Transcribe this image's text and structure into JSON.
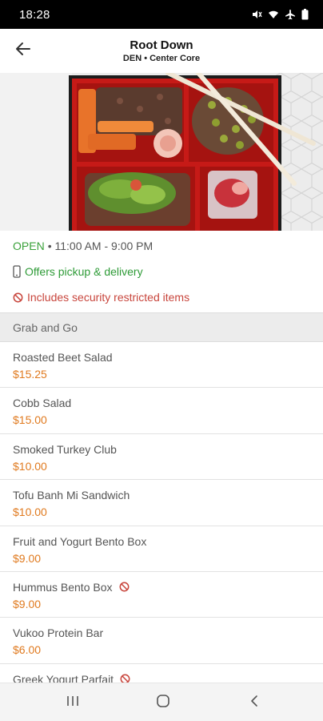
{
  "status_bar": {
    "time": "18:28",
    "icons": [
      "mute-icon",
      "wifi-icon",
      "airplane-icon",
      "battery-icon"
    ]
  },
  "header": {
    "title": "Root Down",
    "subtitle": "DEN • Center Core",
    "back_icon": "arrow-left-icon"
  },
  "hero_image": {
    "subject": "bento box meal"
  },
  "info": {
    "open_label": "OPEN",
    "hours": "• 11:00 AM - 9:00 PM",
    "pickup_text": "Offers pickup & delivery",
    "security_text": "Includes security restricted items"
  },
  "colors": {
    "open_green": "#3aa13a",
    "pickup_green": "#2e9b37",
    "restricted_red": "#c8453c",
    "price_orange": "#e07a1f"
  },
  "section": {
    "title": "Grab and Go"
  },
  "menu_items": [
    {
      "name": "Roasted Beet Salad",
      "price": "$15.25",
      "restricted": false
    },
    {
      "name": "Cobb Salad",
      "price": "$15.00",
      "restricted": false
    },
    {
      "name": "Smoked Turkey Club",
      "price": "$10.00",
      "restricted": false
    },
    {
      "name": "Tofu Banh Mi Sandwich",
      "price": "$10.00",
      "restricted": false
    },
    {
      "name": "Fruit and Yogurt Bento Box",
      "price": "$9.00",
      "restricted": false
    },
    {
      "name": "Hummus Bento Box",
      "price": "$9.00",
      "restricted": true
    },
    {
      "name": "Vukoo Protein Bar",
      "price": "$6.00",
      "restricted": false
    },
    {
      "name": "Greek Yogurt Parfait",
      "price": "",
      "restricted": true
    }
  ],
  "nav": {
    "icons": [
      "recents-icon",
      "home-icon",
      "back-icon"
    ]
  }
}
